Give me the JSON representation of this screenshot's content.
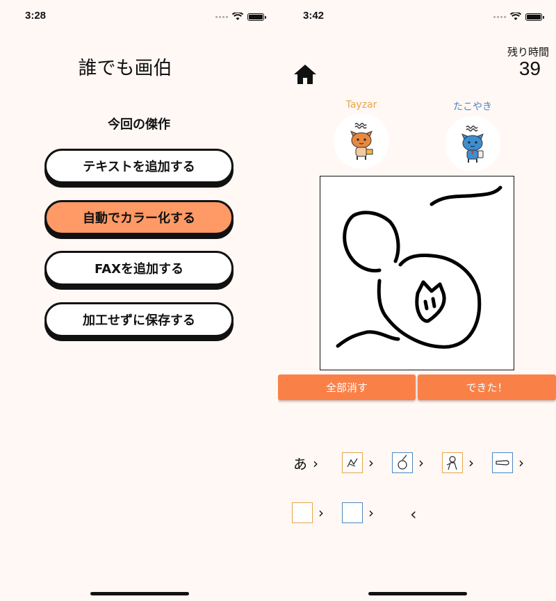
{
  "left": {
    "status_time": "3:28",
    "logo": "誰でも画伯",
    "subtitle": "今回の傑作",
    "buttons": {
      "add_text": "テキストを追加する",
      "auto_color": "自動でカラー化する",
      "add_fax": "FAXを追加する",
      "save_plain": "加工せずに保存する"
    }
  },
  "right": {
    "status_time": "3:42",
    "timer_label": "残り時間",
    "timer_value": "39",
    "players": [
      {
        "name": "Tayzar",
        "color": "#e8a447"
      },
      {
        "name": "たこやき",
        "color": "#4a87c2"
      }
    ],
    "clear_all": "全部消す",
    "done": "できた！",
    "history_first": "あ",
    "accent": "#f98148",
    "border_orange": "#e8a447",
    "border_blue": "#4a87c2"
  }
}
